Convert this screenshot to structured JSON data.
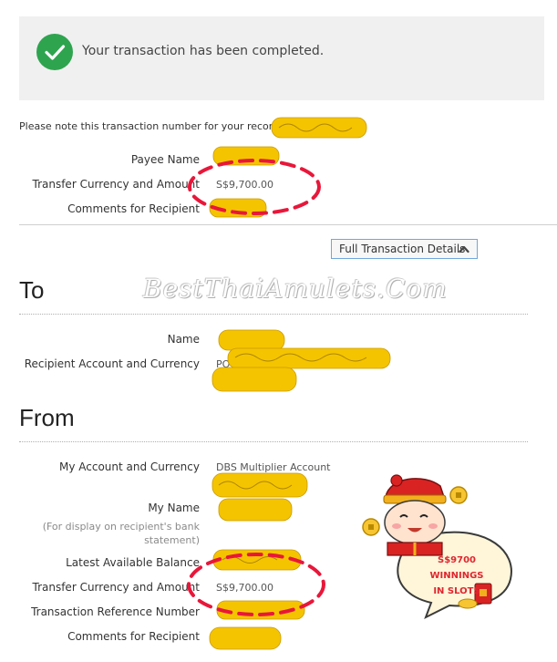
{
  "status": {
    "message": "Your transaction has been completed.",
    "icon": "check-icon",
    "icon_color": "#2ea44f"
  },
  "note_text": "Please note this transaction number for your records:",
  "summary": {
    "payee_name_label": "Payee Name",
    "transfer_label": "Transfer Currency and Amount",
    "transfer_value": "S$9,700.00",
    "comments_label": "Comments for Recipient"
  },
  "full_details_button": {
    "label": "Full Transaction Details",
    "icon": "chevron-up-icon"
  },
  "to_section": {
    "title": "To",
    "name_label": "Name",
    "account_label": "Recipient Account and Currency",
    "account_value_prefix": "PO"
  },
  "watermark": "BestThaiAmulets.Com",
  "from_section": {
    "title": "From",
    "my_account_label": "My Account and Currency",
    "my_account_value": "DBS Multiplier Account",
    "my_name_label": "My Name",
    "my_name_hint": "(For display on recipient's bank statement)",
    "balance_label": "Latest Available Balance",
    "transfer_label": "Transfer Currency and Amount",
    "transfer_value": "S$9,700.00",
    "reference_label": "Transaction Reference Number",
    "comments_label": "Comments for Recipient"
  },
  "sticker": {
    "line1": "S$9700 WINNINGS",
    "line2": "IN SLOTS"
  },
  "colors": {
    "redaction": "#f5c400",
    "highlight_circle": "#e8173a",
    "button_border": "#6fa8dc"
  }
}
